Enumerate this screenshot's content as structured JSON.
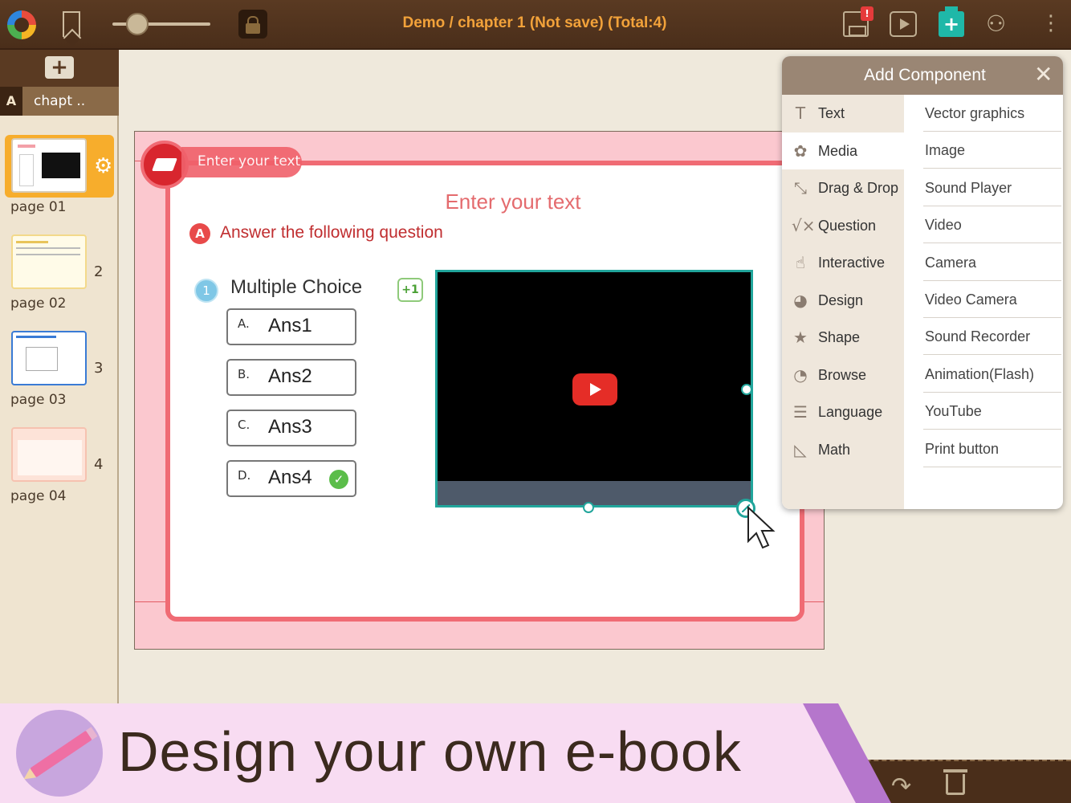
{
  "topbar": {
    "title": "Demo / chapter 1 (Not save) (Total:4)",
    "save_alert": "!",
    "zoom_level": 0.25
  },
  "sidebar": {
    "add_button": "+",
    "chapter": {
      "letter": "A",
      "name": "chapt .."
    },
    "pages": [
      {
        "label": "page 01",
        "number": "",
        "selected": true
      },
      {
        "label": "page 02",
        "number": "2",
        "selected": false
      },
      {
        "label": "page 03",
        "number": "3",
        "selected": false
      },
      {
        "label": "page 04",
        "number": "4",
        "selected": false
      }
    ]
  },
  "canvas": {
    "header_placeholder": "Enter your text",
    "title": "Enter your text",
    "section_badge": "A",
    "instruction": "Answer the following question",
    "question": {
      "number": "1",
      "title": "Multiple Choice",
      "score": "+1",
      "answers": [
        {
          "letter": "A.",
          "text": "Ans1",
          "correct": false
        },
        {
          "letter": "B.",
          "text": "Ans2",
          "correct": false
        },
        {
          "letter": "C.",
          "text": "Ans3",
          "correct": false
        },
        {
          "letter": "D.",
          "text": "Ans4",
          "correct": true
        }
      ]
    }
  },
  "panel": {
    "title": "Add Component",
    "close": "✕",
    "categories": [
      {
        "label": "Text",
        "icon": "T",
        "active": false
      },
      {
        "label": "Media",
        "icon": "✿",
        "active": true
      },
      {
        "label": "Drag & Drop",
        "icon": "⤡",
        "active": false
      },
      {
        "label": "Question",
        "icon": "√×",
        "active": false
      },
      {
        "label": "Interactive",
        "icon": "☝",
        "active": false
      },
      {
        "label": "Design",
        "icon": "◕",
        "active": false
      },
      {
        "label": "Shape",
        "icon": "★",
        "active": false
      },
      {
        "label": "Browse",
        "icon": "◔",
        "active": false
      },
      {
        "label": "Language",
        "icon": "☰",
        "active": false
      },
      {
        "label": "Math",
        "icon": "◺",
        "active": false
      }
    ],
    "media_items": [
      "Vector graphics",
      "Image",
      "Sound Player",
      "Video",
      "Camera",
      "Video Camera",
      "Sound Recorder",
      "Animation(Flash)",
      "YouTube",
      "Print button"
    ]
  },
  "banner": {
    "text": "Design your own e-book"
  },
  "colors": {
    "accent": "#f2a23a",
    "brand_bar": "#4a2e1a",
    "selection": "#21a59b",
    "card_border": "#f06b74"
  }
}
